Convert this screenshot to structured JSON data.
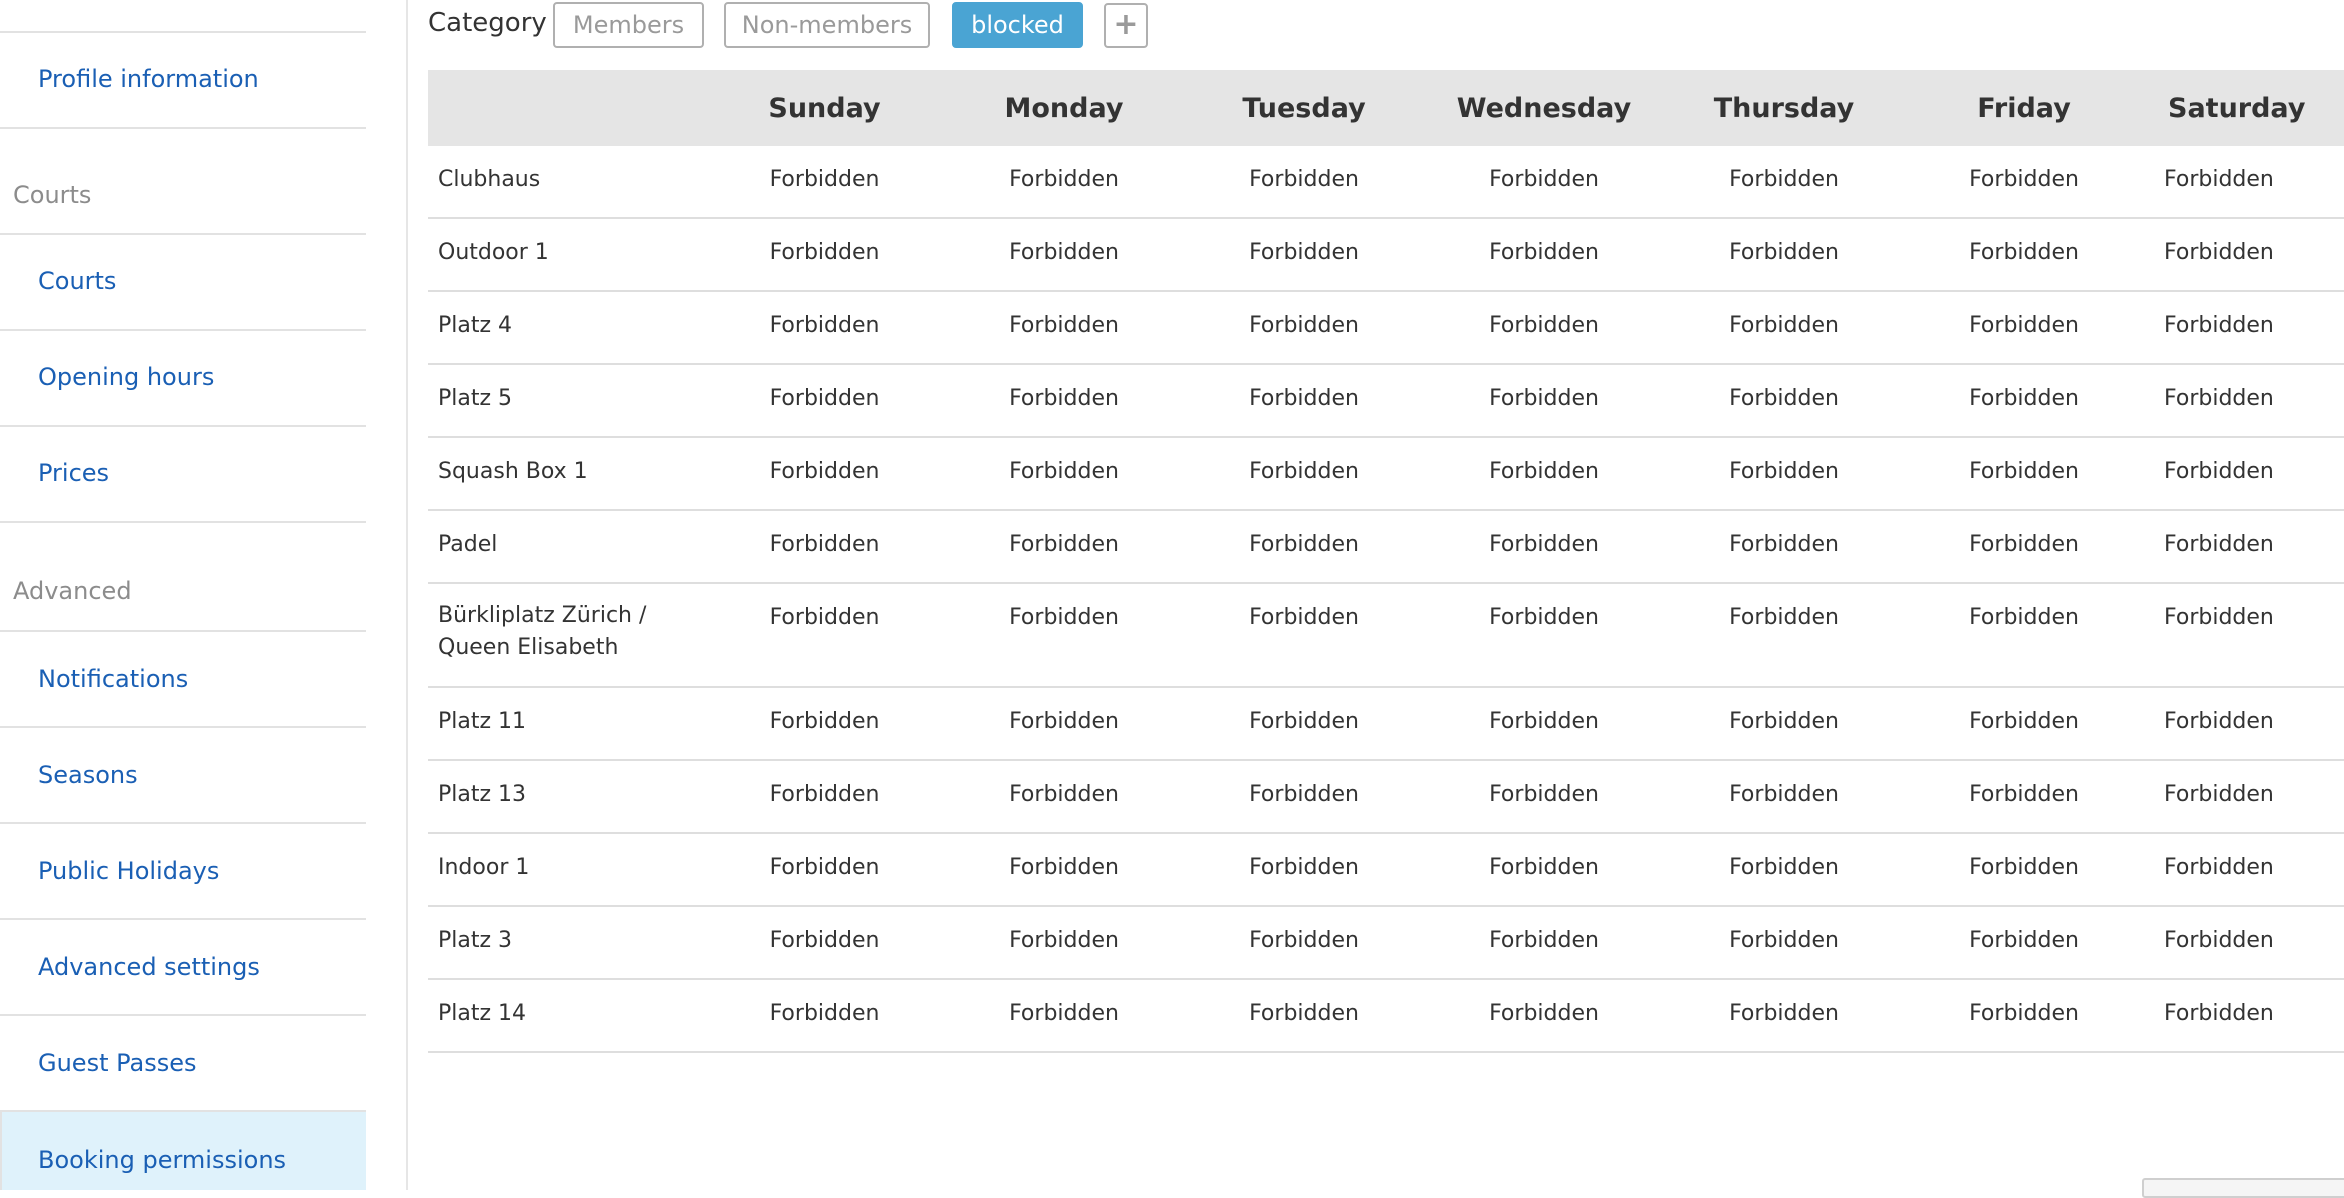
{
  "sidebar": {
    "profile_label": "Profile information",
    "section_courts": "Courts",
    "courts_label": "Courts",
    "opening_hours_label": "Opening hours",
    "prices_label": "Prices",
    "section_advanced": "Advanced",
    "notifications_label": "Notifications",
    "seasons_label": "Seasons",
    "public_holidays_label": "Public Holidays",
    "advanced_settings_label": "Advanced settings",
    "guest_passes_label": "Guest Passes",
    "booking_permissions_label": "Booking permissions"
  },
  "category": {
    "label": "Category",
    "options": [
      "Members",
      "Non-members",
      "blocked"
    ],
    "selected": "blocked",
    "add_icon": "plus-icon",
    "add_symbol": "+"
  },
  "colors": {
    "link": "#1a5fb4",
    "active_button": "#4aa4d3",
    "active_nav_bg": "#dff2fb",
    "header_bg": "#e5e5e5"
  },
  "table": {
    "days": [
      "Sunday",
      "Monday",
      "Tuesday",
      "Wednesday",
      "Thursday",
      "Friday",
      "Saturday"
    ],
    "rows": [
      {
        "court": "Clubhaus",
        "values": [
          "Forbidden",
          "Forbidden",
          "Forbidden",
          "Forbidden",
          "Forbidden",
          "Forbidden",
          "Forbidden"
        ]
      },
      {
        "court": "Outdoor 1",
        "values": [
          "Forbidden",
          "Forbidden",
          "Forbidden",
          "Forbidden",
          "Forbidden",
          "Forbidden",
          "Forbidden"
        ]
      },
      {
        "court": "Platz 4",
        "values": [
          "Forbidden",
          "Forbidden",
          "Forbidden",
          "Forbidden",
          "Forbidden",
          "Forbidden",
          "Forbidden"
        ]
      },
      {
        "court": "Platz 5",
        "values": [
          "Forbidden",
          "Forbidden",
          "Forbidden",
          "Forbidden",
          "Forbidden",
          "Forbidden",
          "Forbidden"
        ]
      },
      {
        "court": "Squash Box 1",
        "values": [
          "Forbidden",
          "Forbidden",
          "Forbidden",
          "Forbidden",
          "Forbidden",
          "Forbidden",
          "Forbidden"
        ]
      },
      {
        "court": "Padel",
        "values": [
          "Forbidden",
          "Forbidden",
          "Forbidden",
          "Forbidden",
          "Forbidden",
          "Forbidden",
          "Forbidden"
        ]
      },
      {
        "court": "Bürkliplatz Zürich / Queen Elisabeth",
        "values": [
          "Forbidden",
          "Forbidden",
          "Forbidden",
          "Forbidden",
          "Forbidden",
          "Forbidden",
          "Forbidden"
        ]
      },
      {
        "court": "Platz 11",
        "values": [
          "Forbidden",
          "Forbidden",
          "Forbidden",
          "Forbidden",
          "Forbidden",
          "Forbidden",
          "Forbidden"
        ]
      },
      {
        "court": "Platz 13",
        "values": [
          "Forbidden",
          "Forbidden",
          "Forbidden",
          "Forbidden",
          "Forbidden",
          "Forbidden",
          "Forbidden"
        ]
      },
      {
        "court": "Indoor 1",
        "values": [
          "Forbidden",
          "Forbidden",
          "Forbidden",
          "Forbidden",
          "Forbidden",
          "Forbidden",
          "Forbidden"
        ]
      },
      {
        "court": "Platz 3",
        "values": [
          "Forbidden",
          "Forbidden",
          "Forbidden",
          "Forbidden",
          "Forbidden",
          "Forbidden",
          "Forbidden"
        ]
      },
      {
        "court": "Platz 14",
        "values": [
          "Forbidden",
          "Forbidden",
          "Forbidden",
          "Forbidden",
          "Forbidden",
          "Forbidden",
          "Forbidden"
        ]
      }
    ]
  }
}
